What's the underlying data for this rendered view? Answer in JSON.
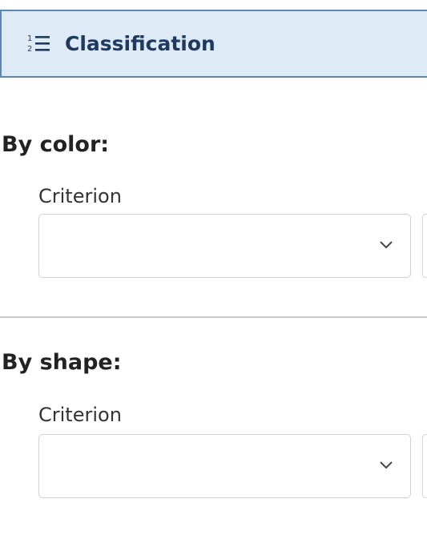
{
  "header": {
    "title": "Classification",
    "icon": "numbered-list-icon"
  },
  "sections": [
    {
      "title": "By color:",
      "field_label": "Criterion",
      "selected_value": "",
      "dropdown_icon": "chevron-down-icon"
    },
    {
      "title": "By shape:",
      "field_label": "Criterion",
      "selected_value": "",
      "dropdown_icon": "chevron-down-icon"
    }
  ],
  "colors": {
    "header_background": "#deebf7",
    "header_border": "#5b87b8",
    "header_text": "#1f3a5f"
  }
}
